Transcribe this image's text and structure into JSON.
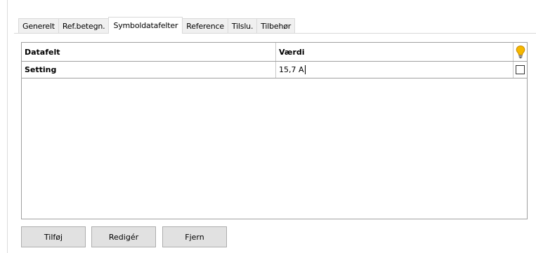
{
  "tabs": [
    {
      "label": "Generelt",
      "active": false
    },
    {
      "label": "Ref.betegn.",
      "active": false
    },
    {
      "label": "Symboldatafelter",
      "active": true
    },
    {
      "label": "Reference",
      "active": false
    },
    {
      "label": "Tilslu.",
      "active": false
    },
    {
      "label": "Tilbehør",
      "active": false
    }
  ],
  "grid": {
    "columns": [
      "Datafelt",
      "Værdi"
    ],
    "header_icon": "lightbulb-icon",
    "rows": [
      {
        "field": "Setting",
        "value": "15,7 A",
        "checked": false
      }
    ]
  },
  "buttons": {
    "add": "Tilføj",
    "edit": "Redigér",
    "remove": "Fjern"
  },
  "colors": {
    "tab_active_bg": "#ffffff",
    "tab_bg": "#f0f0f0",
    "border": "#a0a0a0",
    "button_bg": "#e1e1e1",
    "bulb": "#f5b800"
  }
}
